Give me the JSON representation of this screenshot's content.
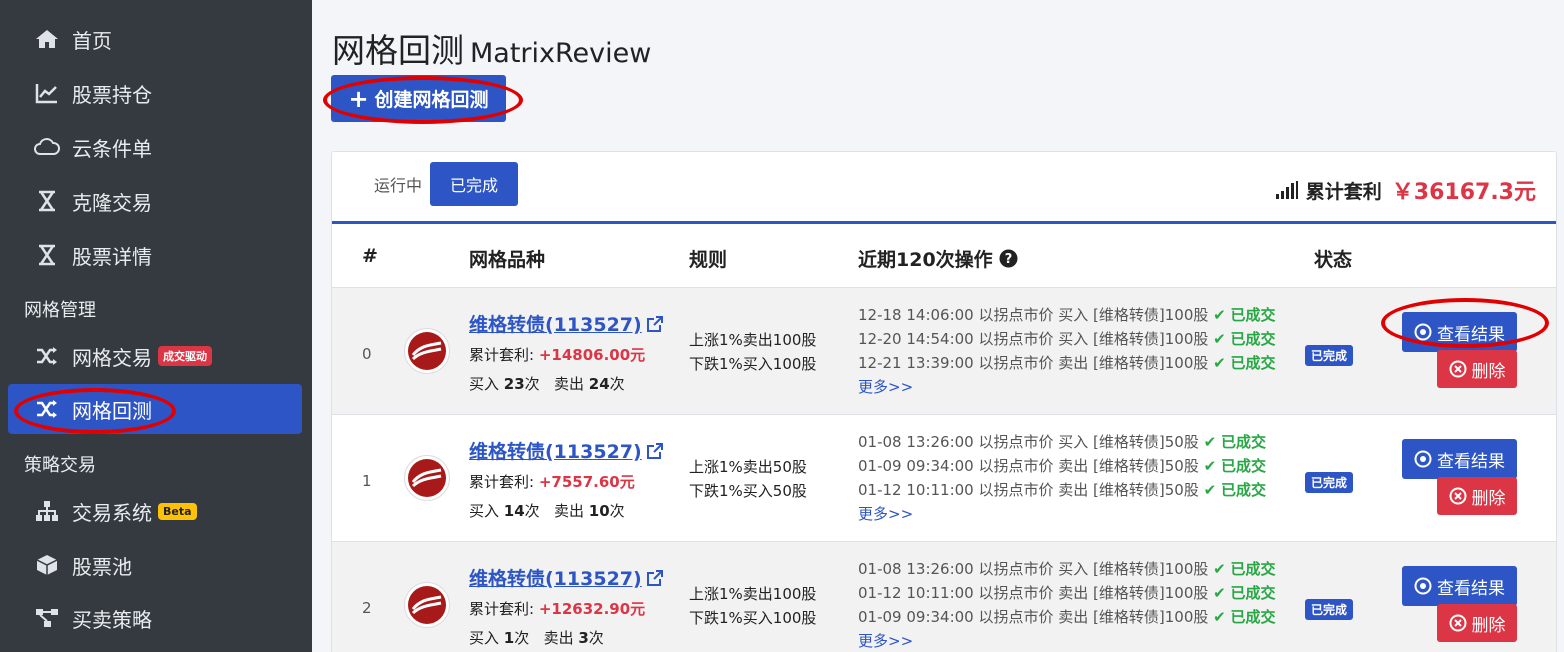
{
  "sidebar": {
    "items": [
      {
        "label": "首页",
        "icon": "home-icon"
      },
      {
        "label": "股票持仓",
        "icon": "chart-line-icon"
      },
      {
        "label": "云条件单",
        "icon": "cloud-icon"
      },
      {
        "label": "克隆交易",
        "icon": "hourglass-icon"
      },
      {
        "label": "股票详情",
        "icon": "hourglass-icon"
      }
    ],
    "section_grid": "网格管理",
    "grid_items": [
      {
        "label": "网格交易",
        "badge": "成交驱动",
        "icon": "shuffle-icon"
      },
      {
        "label": "网格回测",
        "icon": "shuffle-icon"
      }
    ],
    "section_strategy": "策略交易",
    "strategy_items": [
      {
        "label": "交易系统",
        "badge": "Beta",
        "icon": "sitemap-icon"
      },
      {
        "label": "股票池",
        "icon": "cube-icon"
      },
      {
        "label": "买卖策略",
        "icon": "flow-icon"
      }
    ]
  },
  "header": {
    "title": "网格回测",
    "subtitle": "MatrixReview",
    "create_label": "创建网格回测"
  },
  "tabs": {
    "running": "运行中",
    "done": "已完成"
  },
  "total_profit": {
    "label": "累计套利",
    "value": "￥36167.3元"
  },
  "table": {
    "headers": [
      "#",
      "网格品种",
      "规则",
      "近期120次操作",
      "状态"
    ],
    "rows": [
      {
        "idx": "0",
        "name": "维格转债(113527)",
        "cum_label": "累计套利:",
        "cum_value": "+14806.00元",
        "buy_label": "买入",
        "buy_count": "23",
        "sell_label": "卖出",
        "sell_count": "24",
        "times": "次",
        "rule1": "上涨1%卖出100股",
        "rule2": "下跌1%买入100股",
        "ops": [
          {
            "text": "12-18 14:06:00 以拐点市价 买入 [维格转债]100股",
            "status": "已成交"
          },
          {
            "text": "12-20 14:54:00 以拐点市价 买入 [维格转债]100股",
            "status": "已成交"
          },
          {
            "text": "12-21 13:39:00 以拐点市价 卖出 [维格转债]100股",
            "status": "已成交"
          }
        ],
        "more": "更多>>",
        "status": "已完成",
        "view_label": "查看结果",
        "del_label": "删除"
      },
      {
        "idx": "1",
        "name": "维格转债(113527)",
        "cum_label": "累计套利:",
        "cum_value": "+7557.60元",
        "buy_label": "买入",
        "buy_count": "14",
        "sell_label": "卖出",
        "sell_count": "10",
        "times": "次",
        "rule1": "上涨1%卖出50股",
        "rule2": "下跌1%买入50股",
        "ops": [
          {
            "text": "01-08 13:26:00 以拐点市价 买入 [维格转债]50股",
            "status": "已成交"
          },
          {
            "text": "01-09 09:34:00 以拐点市价 卖出 [维格转债]50股",
            "status": "已成交"
          },
          {
            "text": "01-12 10:11:00 以拐点市价 卖出 [维格转债]50股",
            "status": "已成交"
          }
        ],
        "more": "更多>>",
        "status": "已完成",
        "view_label": "查看结果",
        "del_label": "删除"
      },
      {
        "idx": "2",
        "name": "维格转债(113527)",
        "cum_label": "累计套利:",
        "cum_value": "+12632.90元",
        "buy_label": "买入",
        "buy_count": "1",
        "sell_label": "卖出",
        "sell_count": "3",
        "times": "次",
        "rule1": "上涨1%卖出100股",
        "rule2": "下跌1%买入100股",
        "ops": [
          {
            "text": "01-08 13:26:00 以拐点市价 买入 [维格转债]100股",
            "status": "已成交"
          },
          {
            "text": "01-12 10:11:00 以拐点市价 卖出 [维格转债]100股",
            "status": "已成交"
          },
          {
            "text": "01-09 09:34:00 以拐点市价 卖出 [维格转债]100股",
            "status": "已成交"
          }
        ],
        "more": "更多>>",
        "status": "已完成",
        "view_label": "查看结果",
        "del_label": "删除"
      }
    ]
  }
}
